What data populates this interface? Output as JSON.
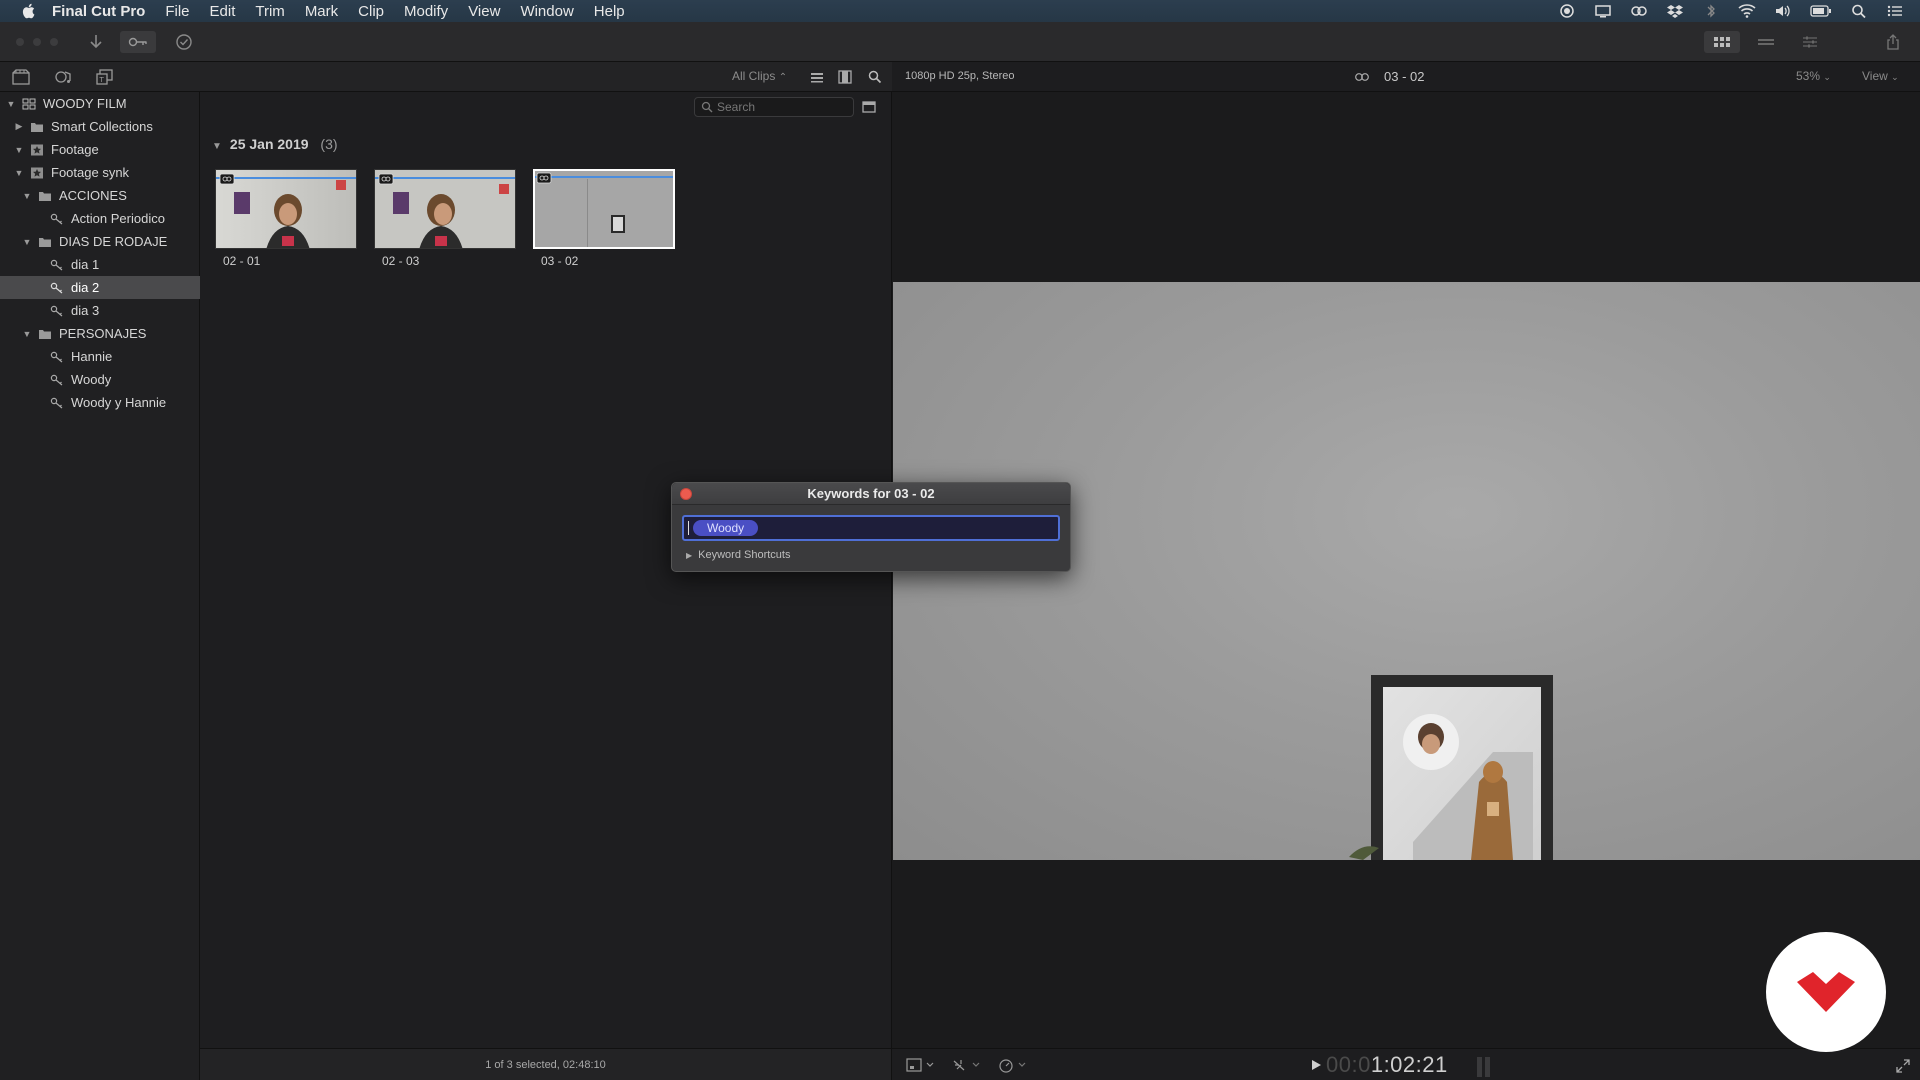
{
  "menubar": {
    "app_name": "Final Cut Pro",
    "items": [
      "File",
      "Edit",
      "Trim",
      "Mark",
      "Clip",
      "Modify",
      "View",
      "Window",
      "Help"
    ]
  },
  "library": {
    "rows": [
      {
        "label": "WOODY FILM",
        "icon": "library-icon",
        "expanded": true
      },
      {
        "label": "Smart Collections",
        "icon": "folder-icon",
        "expanded": false
      },
      {
        "label": "Footage",
        "icon": "event-icon",
        "expanded": true
      },
      {
        "label": "Footage synk",
        "icon": "event-icon",
        "expanded": true
      },
      {
        "label": "ACCIONES",
        "icon": "folder-icon",
        "expanded": true
      },
      {
        "label": "Action Periodico",
        "icon": "keyword-icon"
      },
      {
        "label": "DIAS DE RODAJE",
        "icon": "folder-icon",
        "expanded": true
      },
      {
        "label": "dia 1",
        "icon": "keyword-icon"
      },
      {
        "label": "dia 2",
        "icon": "keyword-icon",
        "selected": true
      },
      {
        "label": "dia 3",
        "icon": "keyword-icon"
      },
      {
        "label": "PERSONAJES",
        "icon": "folder-icon",
        "expanded": true
      },
      {
        "label": "Hannie",
        "icon": "keyword-icon"
      },
      {
        "label": "Woody",
        "icon": "keyword-icon"
      },
      {
        "label": "Woody y Hannie",
        "icon": "keyword-icon"
      }
    ]
  },
  "browser": {
    "filter_label": "All Clips",
    "search_placeholder": "Search",
    "group_title": "25 Jan 2019",
    "group_count": "(3)",
    "clips": [
      {
        "name": "02 - 01",
        "selected": false
      },
      {
        "name": "02 - 03",
        "selected": false
      },
      {
        "name": "03 - 02",
        "selected": true
      }
    ],
    "footer_status": "1 of 3 selected, 02:48:10"
  },
  "viewer": {
    "format": "1080p HD 25p, Stereo",
    "clip_name": "03 - 02",
    "zoom": "53%",
    "view_label": "View",
    "timecode_dim": "00:0",
    "timecode_bright": "1:02:21"
  },
  "keyword_dialog": {
    "title": "Keywords for 03 - 02",
    "token": "Woody",
    "shortcuts_label": "Keyword Shortcuts"
  },
  "colors": {
    "accent_blue": "#4f6fd6",
    "token_purple": "#4a4fc4",
    "close_red": "#ec5b4f",
    "logo_red": "#e0242b"
  }
}
